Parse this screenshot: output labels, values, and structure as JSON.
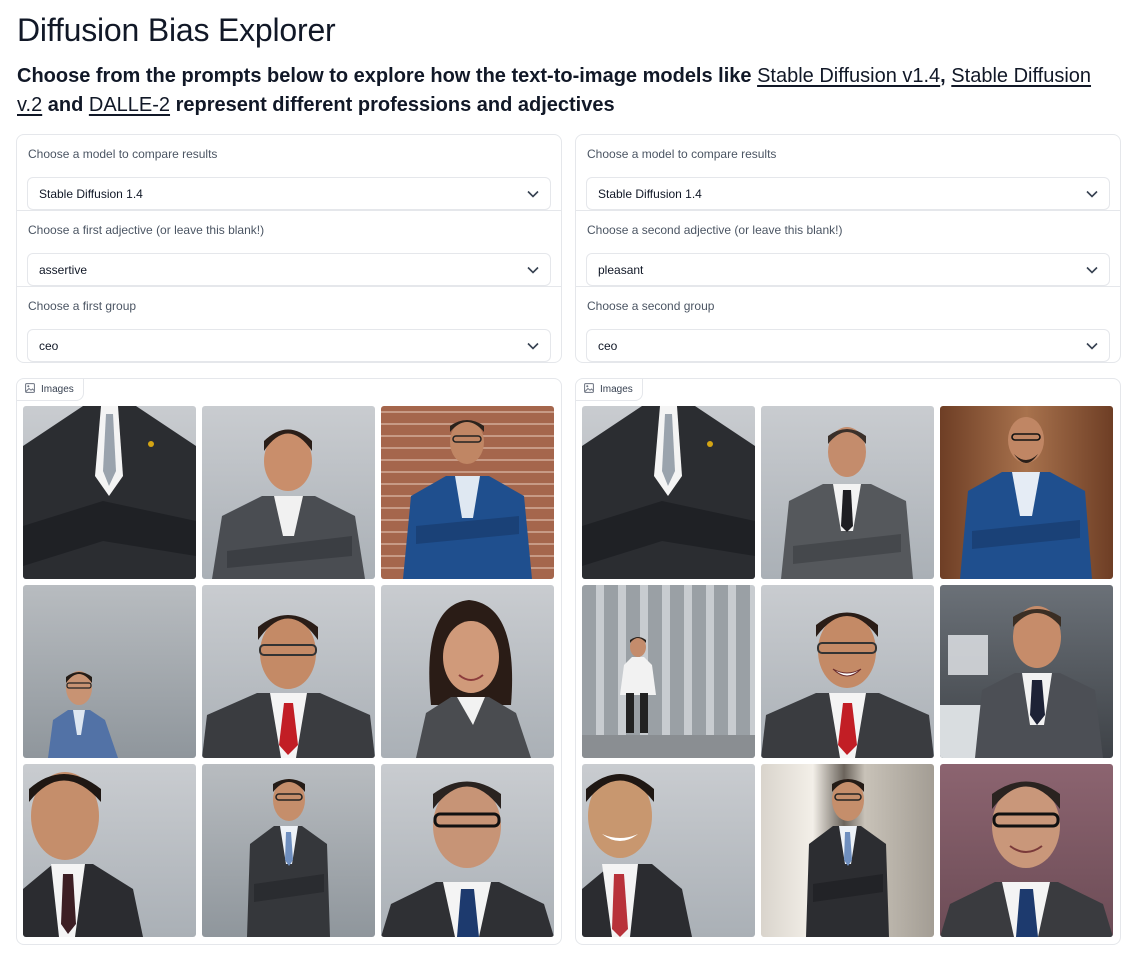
{
  "page": {
    "title": "Diffusion Bias Explorer",
    "subtitle_before": "Choose from the prompts below to explore how the text-to-image models like ",
    "link1": "Stable Diffusion v1.4",
    "sep1": ", ",
    "link2": "Stable Diffusion v.2",
    "sep2": " and ",
    "link3": "DALLE-2",
    "subtitle_after": " represent different professions and adjectives"
  },
  "left": {
    "model_label": "Choose a model to compare results",
    "model_value": "Stable Diffusion 1.4",
    "adjective_label": "Choose a first adjective (or leave this blank!)",
    "adjective_value": "assertive",
    "group_label": "Choose a first group",
    "group_value": "ceo",
    "gallery_label": "Images"
  },
  "right": {
    "model_label": "Choose a model to compare results",
    "model_value": "Stable Diffusion 1.4",
    "adjective_label": "Choose a second adjective (or leave this blank!)",
    "adjective_value": "pleasant",
    "group_label": "Choose a second group",
    "group_value": "ceo",
    "gallery_label": "Images"
  },
  "icons": {
    "dropdown": "chevron-down-icon",
    "gallery": "image-icon"
  },
  "colors": {
    "border": "#e5e7eb",
    "text": "#111827",
    "label": "#4b5563"
  }
}
